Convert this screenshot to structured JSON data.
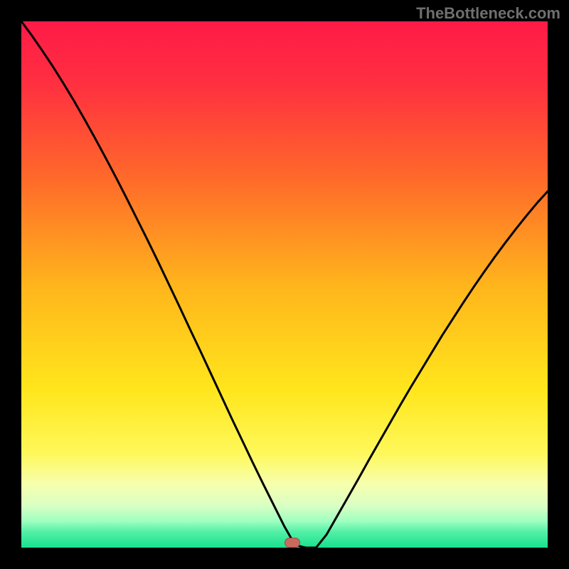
{
  "watermark": "TheBottleneck.com",
  "marker": {
    "x_pct": 51.5,
    "y_pct": 99,
    "color": "#c96a5f"
  },
  "gradient_stops": [
    {
      "offset": 0,
      "color": "#ff1a47"
    },
    {
      "offset": 12,
      "color": "#ff3040"
    },
    {
      "offset": 30,
      "color": "#ff6a2a"
    },
    {
      "offset": 50,
      "color": "#ffb41c"
    },
    {
      "offset": 70,
      "color": "#ffe61c"
    },
    {
      "offset": 82,
      "color": "#fff85a"
    },
    {
      "offset": 88,
      "color": "#f6ffae"
    },
    {
      "offset": 92,
      "color": "#d9ffc4"
    },
    {
      "offset": 95,
      "color": "#9effc0"
    },
    {
      "offset": 97,
      "color": "#52f0a6"
    },
    {
      "offset": 100,
      "color": "#18e08e"
    }
  ],
  "chart_data": {
    "type": "line",
    "title": "",
    "xlabel": "",
    "ylabel": "",
    "xlim": [
      0,
      100
    ],
    "ylim": [
      0,
      100
    ],
    "x": [
      0,
      2,
      4,
      6,
      8,
      10,
      12,
      14,
      16,
      18,
      20,
      22,
      24,
      26,
      28,
      30,
      32,
      34,
      36,
      38,
      40,
      42,
      44,
      46,
      48,
      50,
      52,
      54,
      56,
      58,
      60,
      62,
      64,
      66,
      68,
      70,
      72,
      74,
      76,
      78,
      80,
      82,
      84,
      86,
      88,
      90,
      92,
      94,
      96,
      98,
      100
    ],
    "values": [
      100,
      97.3,
      94.4,
      91.4,
      88.2,
      84.9,
      81.4,
      77.8,
      74.1,
      70.3,
      66.4,
      62.4,
      58.4,
      54.3,
      50.1,
      45.9,
      41.6,
      37.4,
      33.1,
      28.8,
      24.5,
      20.3,
      16.1,
      12.0,
      8.0,
      4.0,
      0.5,
      0.0,
      0.0,
      2.5,
      6.0,
      9.5,
      13.0,
      16.6,
      20.1,
      23.6,
      27.1,
      30.5,
      33.8,
      37.1,
      40.4,
      43.5,
      46.6,
      49.6,
      52.5,
      55.3,
      58.0,
      60.6,
      63.1,
      65.5,
      67.7
    ],
    "note": "Values are percentage height read from the y-position of the curve; x in percent of plot width."
  }
}
